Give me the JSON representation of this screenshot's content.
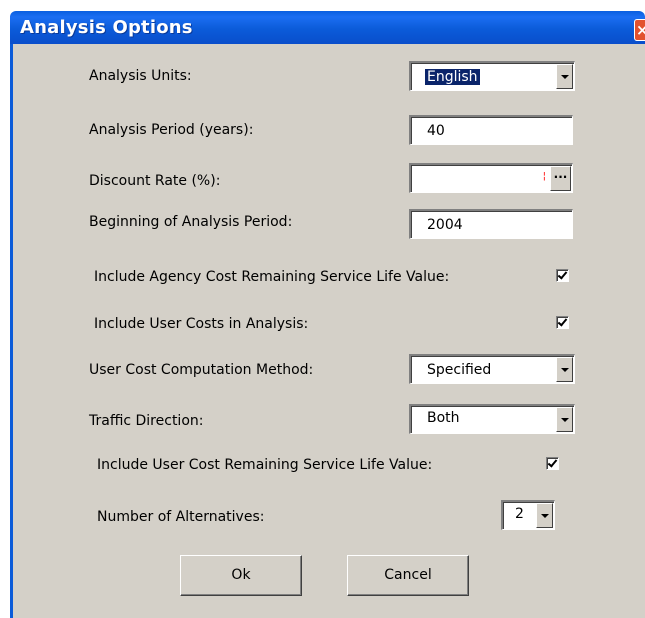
{
  "window": {
    "title": "Analysis Options",
    "close_glyph": "×"
  },
  "fields": {
    "analysis_units": {
      "label": "Analysis Units:",
      "value": "English"
    },
    "analysis_period": {
      "label": "Analysis Period (years):",
      "value": "40"
    },
    "discount_rate": {
      "label": "Discount Rate (%):",
      "value": "",
      "button_label": "...",
      "indicator": "¦"
    },
    "beginning_period": {
      "label": "Beginning of Analysis Period:",
      "value": "2004"
    },
    "agency_cost_rsl": {
      "label": "Include Agency Cost Remaining Service Life Value:",
      "checked": true
    },
    "user_costs": {
      "label": "Include User Costs in Analysis:",
      "checked": true
    },
    "user_cost_method": {
      "label": "User Cost Computation Method:",
      "value": "Specified"
    },
    "traffic_direction": {
      "label": "Traffic Direction:",
      "value": "Both"
    },
    "user_cost_rsl": {
      "label": "Include User Cost Remaining Service Life Value:",
      "checked": true
    },
    "num_alternatives": {
      "label": "Number of Alternatives:",
      "value": "2"
    }
  },
  "buttons": {
    "ok": "Ok",
    "cancel": "Cancel"
  },
  "colors": {
    "titlebar": "#0b5bd9",
    "dialog_bg": "#d4d0c8",
    "selection": "#0a246a",
    "close_button": "#e2522f"
  }
}
